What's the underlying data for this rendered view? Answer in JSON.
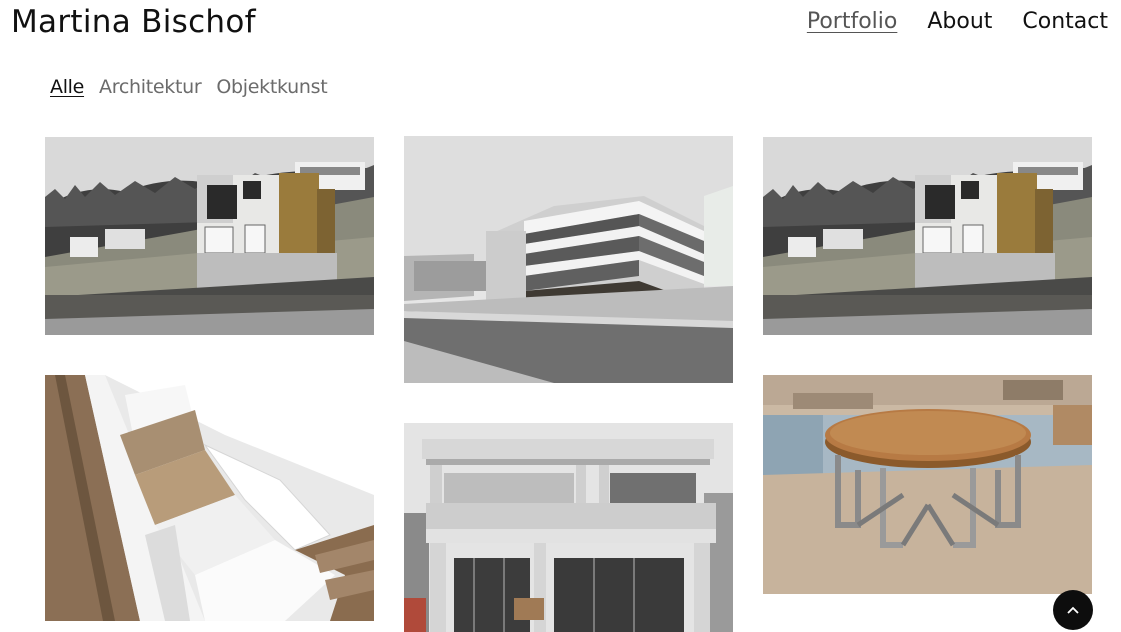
{
  "site": {
    "title": "Martina Bischof"
  },
  "nav": {
    "items": [
      {
        "label": "Portfolio",
        "active": true
      },
      {
        "label": "About",
        "active": false
      },
      {
        "label": "Contact",
        "active": false
      }
    ]
  },
  "filters": {
    "items": [
      {
        "label": "Alle",
        "active": true
      },
      {
        "label": "Architektur",
        "active": false
      },
      {
        "label": "Objektkunst",
        "active": false
      }
    ]
  },
  "portfolio": {
    "tiles": [
      {
        "subject": "hillside house with wood-clad extension"
      },
      {
        "subject": "multi-storey apartment building rendering"
      },
      {
        "subject": "hillside house with wood-clad extension"
      },
      {
        "subject": "white interior staircase"
      },
      {
        "subject": "concrete two-storey house"
      },
      {
        "subject": "round wooden table on steel base"
      }
    ]
  },
  "colors": {
    "accent_dark": "#0d0d0d",
    "inactive_text": "#6b6b6b",
    "active_nav": "#555555"
  },
  "icons": {
    "scroll_top": "chevron-up-icon"
  }
}
